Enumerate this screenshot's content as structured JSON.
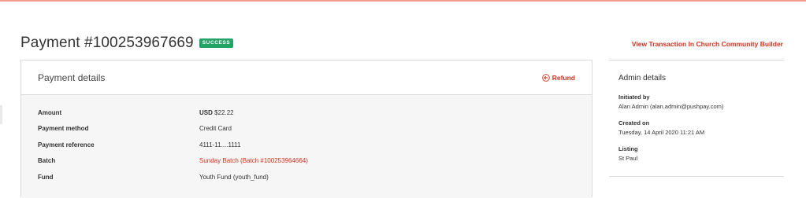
{
  "header": {
    "title": "Payment #100253967669",
    "status_badge": "SUCCESS",
    "view_link": "View Transaction In Church Community Builder"
  },
  "payment_details": {
    "title": "Payment details",
    "refund_label": "Refund",
    "rows": {
      "amount": {
        "label": "Amount",
        "currency": "USD",
        "value": "$22.22"
      },
      "method": {
        "label": "Payment method",
        "value": "Credit Card"
      },
      "reference": {
        "label": "Payment reference",
        "value": "4111-11....1111"
      },
      "batch": {
        "label": "Batch",
        "value": "Sunday Batch (Batch #100253964664)"
      },
      "fund": {
        "label": "Fund",
        "value": "Youth Fund (youth_fund)"
      }
    }
  },
  "admin_details": {
    "title": "Admin details",
    "initiated_by": {
      "label": "Initiated by",
      "value": "Alan Admin (alan.admin@pushpay.com)"
    },
    "created_on": {
      "label": "Created on",
      "value": "Tuesday, 14 April 2020 11:21 AM"
    },
    "listing": {
      "label": "Listing",
      "value": "St Paul"
    }
  },
  "colors": {
    "accent": "#d9301b",
    "success": "#21a366",
    "body_panel": "#f6f6f6",
    "border": "#dadada"
  },
  "icons": {
    "refund": "arrow-left-circle-icon"
  }
}
